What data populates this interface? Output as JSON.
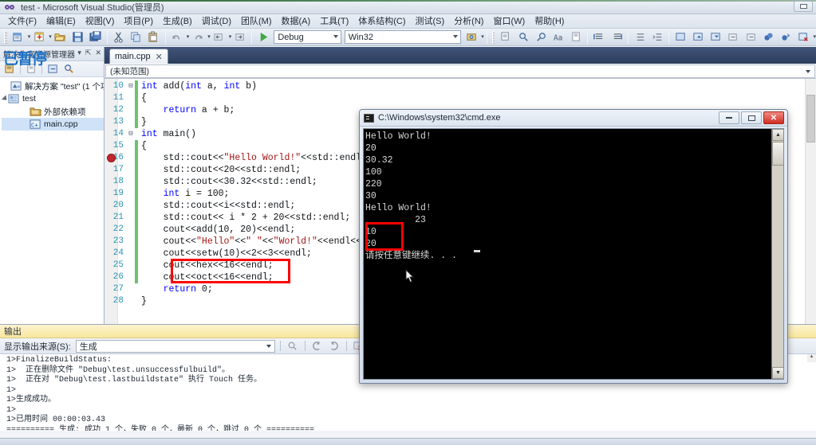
{
  "window": {
    "title": "test - Microsoft Visual Studio(管理员)",
    "logo_icon": "vs-infinity-logo",
    "restore_button_icon": "restore-window-icon"
  },
  "menubar": {
    "items": [
      {
        "label": "文件(F)",
        "name": "menu-file"
      },
      {
        "label": "编辑(E)",
        "name": "menu-edit"
      },
      {
        "label": "视图(V)",
        "name": "menu-view"
      },
      {
        "label": "项目(P)",
        "name": "menu-project"
      },
      {
        "label": "生成(B)",
        "name": "menu-build"
      },
      {
        "label": "调试(D)",
        "name": "menu-debug"
      },
      {
        "label": "团队(M)",
        "name": "menu-team"
      },
      {
        "label": "数据(A)",
        "name": "menu-data"
      },
      {
        "label": "工具(T)",
        "name": "menu-tools"
      },
      {
        "label": "体系结构(C)",
        "name": "menu-architecture"
      },
      {
        "label": "测试(S)",
        "name": "menu-test"
      },
      {
        "label": "分析(N)",
        "name": "menu-analyze"
      },
      {
        "label": "窗口(W)",
        "name": "menu-window"
      },
      {
        "label": "帮助(H)",
        "name": "menu-help"
      }
    ]
  },
  "toolbar": {
    "configuration": "Debug",
    "platform": "Win32",
    "start_label": "启动调试",
    "icons": [
      "new-project-icon",
      "add-new-item-icon",
      "open-file-icon",
      "save-icon",
      "save-all-icon",
      "cut-icon",
      "copy-icon",
      "paste-icon",
      "undo-icon",
      "redo-icon",
      "navigate-backward-icon",
      "navigate-forward-icon",
      "start-debug-icon",
      "find-in-files-icon",
      "comment-icon",
      "uncomment-icon",
      "indent-icon",
      "outdent-icon",
      "toggle-bookmark-icon",
      "clear-bookmarks-icon",
      "toggle-breakpoint-icon",
      "delete-breakpoints-icon"
    ]
  },
  "solution_explorer": {
    "panel_title": "解决方案资源管理器",
    "overlay_text": "已暂停",
    "toolbar_icons": [
      "properties-icon",
      "show-all-files-icon",
      "refresh-icon",
      "property-page-icon"
    ],
    "tree": [
      {
        "label": "解决方案 \"test\" (1 个项",
        "icon": "solution-icon",
        "indent": 0,
        "expander": false,
        "selected": false
      },
      {
        "label": "test",
        "icon": "project-icon",
        "indent": 0,
        "expander": true,
        "selected": false
      },
      {
        "label": "外部依赖项",
        "icon": "folder-icon",
        "indent": 2,
        "expander": false,
        "selected": false
      },
      {
        "label": "main.cpp",
        "icon": "cpp-file-icon",
        "indent": 2,
        "expander": false,
        "selected": true
      }
    ]
  },
  "editor": {
    "tab_label": "main.cpp",
    "tab_close_icon": "close-icon",
    "scope": "(未知范围)",
    "breakpoint_line": 16,
    "highlight_lines": [
      25,
      26
    ],
    "lines": [
      {
        "n": 10,
        "fold": "-",
        "changed": true,
        "text": "int add(int a, int b)"
      },
      {
        "n": 11,
        "fold": "",
        "changed": true,
        "text": "{"
      },
      {
        "n": 12,
        "fold": "",
        "changed": true,
        "text": "    return a + b;"
      },
      {
        "n": 13,
        "fold": "",
        "changed": true,
        "text": "}"
      },
      {
        "n": 14,
        "fold": "-",
        "changed": false,
        "text": "int main()"
      },
      {
        "n": 15,
        "fold": "",
        "changed": true,
        "text": "{"
      },
      {
        "n": 16,
        "fold": "",
        "changed": true,
        "text": "    std::cout<<\"Hello World!\"<<std::endl"
      },
      {
        "n": 17,
        "fold": "",
        "changed": true,
        "text": "    std::cout<<20<<std::endl;"
      },
      {
        "n": 18,
        "fold": "",
        "changed": true,
        "text": "    std::cout<<30.32<<std::endl;"
      },
      {
        "n": 19,
        "fold": "",
        "changed": true,
        "text": "    int i = 100;"
      },
      {
        "n": 20,
        "fold": "",
        "changed": true,
        "text": "    std::cout<<i<<std::endl;"
      },
      {
        "n": 21,
        "fold": "",
        "changed": true,
        "text": "    std::cout<< i * 2 + 20<<std::endl;"
      },
      {
        "n": 22,
        "fold": "",
        "changed": true,
        "text": "    cout<<add(10, 20)<<endl;"
      },
      {
        "n": 23,
        "fold": "",
        "changed": true,
        "text": "    cout<<\"Hello\"<<\" \"<<\"World!\"<<endl<<"
      },
      {
        "n": 24,
        "fold": "",
        "changed": true,
        "text": "    cout<<setw(10)<<2<<3<<endl;"
      },
      {
        "n": 25,
        "fold": "",
        "changed": true,
        "text": "    cout<<hex<<16<<endl;"
      },
      {
        "n": 26,
        "fold": "",
        "changed": true,
        "text": "    cout<<oct<<16<<endl;"
      },
      {
        "n": 27,
        "fold": "",
        "changed": false,
        "text": "    return 0;"
      },
      {
        "n": 28,
        "fold": "",
        "changed": false,
        "text": "}"
      }
    ]
  },
  "console": {
    "title": "C:\\Windows\\system32\\cmd.exe",
    "icon": "cmd-console-icon",
    "minimize_icon": "minimize-icon",
    "maximize_icon": "maximize-icon",
    "close_icon": "close-icon",
    "output": "Hello World!\n20\n30.32\n100\n220\n30\nHello World!\n         23\n10\n20\n请按任意键继续. . .",
    "highlight_values": [
      "10",
      "20"
    ],
    "scroll_up_icon": "scroll-up-arrow",
    "scroll_down_icon": "scroll-down-arrow"
  },
  "output_panel": {
    "title": "输出",
    "source_label": "显示输出来源(S):",
    "source_value": "生成",
    "toolbar_icons": [
      "find-message-icon",
      "go-to-previous-icon",
      "go-to-next-icon",
      "clear-all-icon",
      "toggle-word-wrap-icon"
    ],
    "text": "1>FinalizeBuildStatus:\n1>  正在删除文件 \"Debug\\test.unsuccessfulbuild\"。\n1>  正在对 \"Debug\\test.lastbuildstate\" 执行 Touch 任务。\n1>\n1>生成成功。\n1>\n1>已用时间 00:00:03.43\n========== 生成: 成功 1 个，失败 0 个，最新 0 个，跳过 0 个 =========="
  },
  "colors": {
    "accent_blue": "#1b6fc4",
    "breakpoint_red": "#c0262d",
    "highlight_red": "#ff0000",
    "keyword_blue": "#0000ff",
    "string_red": "#a31515",
    "linenum_teal": "#2b91af",
    "changebar_green": "#6ec26e"
  }
}
